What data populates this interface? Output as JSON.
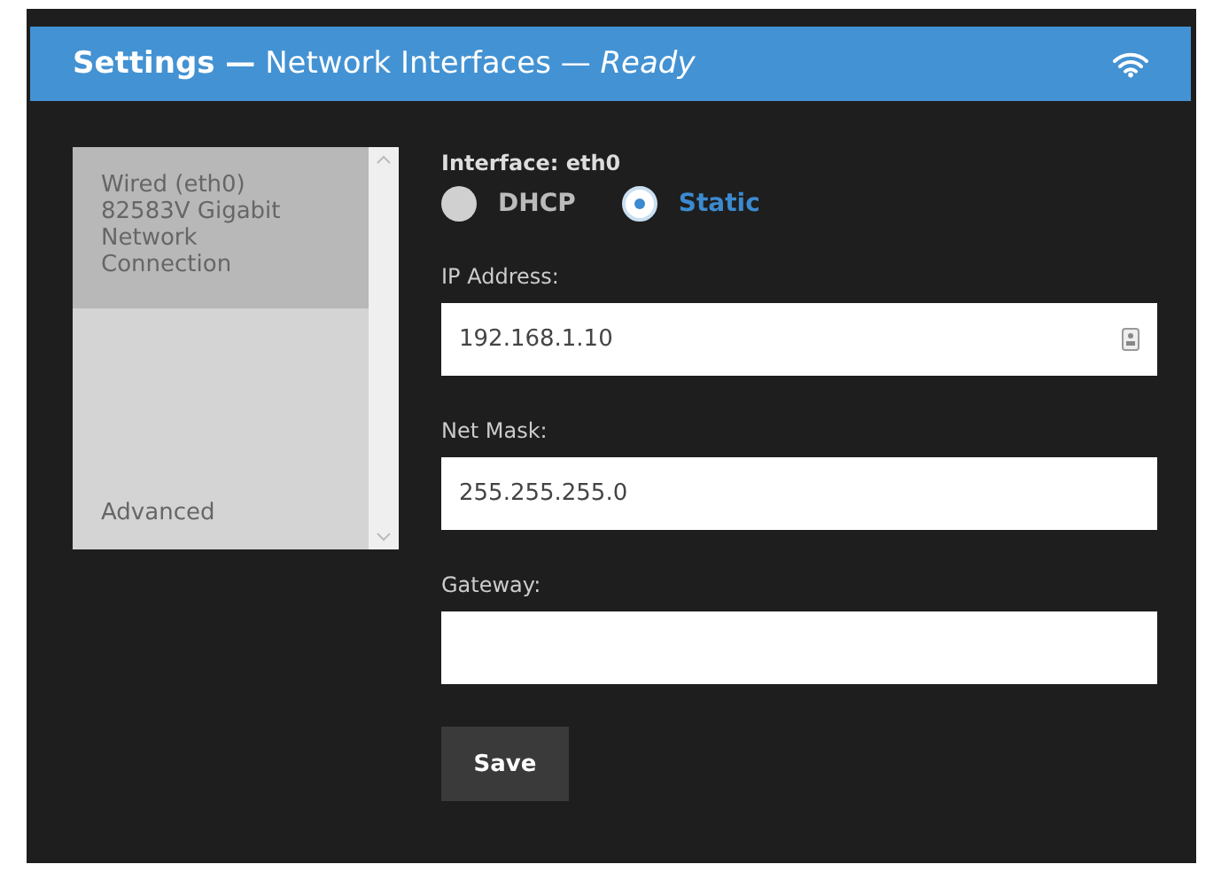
{
  "window": {
    "title": "**Settings —** Network Interfaces — *Ready*"
  },
  "sidebar": {
    "items": [
      {
        "label": "Wired (eth0)\n82583V Gigabit\nNetwork\nConnection",
        "selected": true
      },
      {
        "label": "Advanced",
        "selected": false
      }
    ]
  },
  "form": {
    "heading": "Interface: eth0",
    "modes": [
      {
        "label": "DHCP",
        "selected": false
      },
      {
        "label": "Static",
        "selected": true
      }
    ],
    "fields": [
      {
        "label": "IP Address:",
        "value": "192.168.1.10",
        "kind": "contact"
      },
      {
        "label": "Net Mask:",
        "value": "255.255.255.0",
        "kind": "plain"
      },
      {
        "label": "Gateway:",
        "kind": "plain"
      }
    ],
    "buttons": [
      "Save"
    ]
  }
}
